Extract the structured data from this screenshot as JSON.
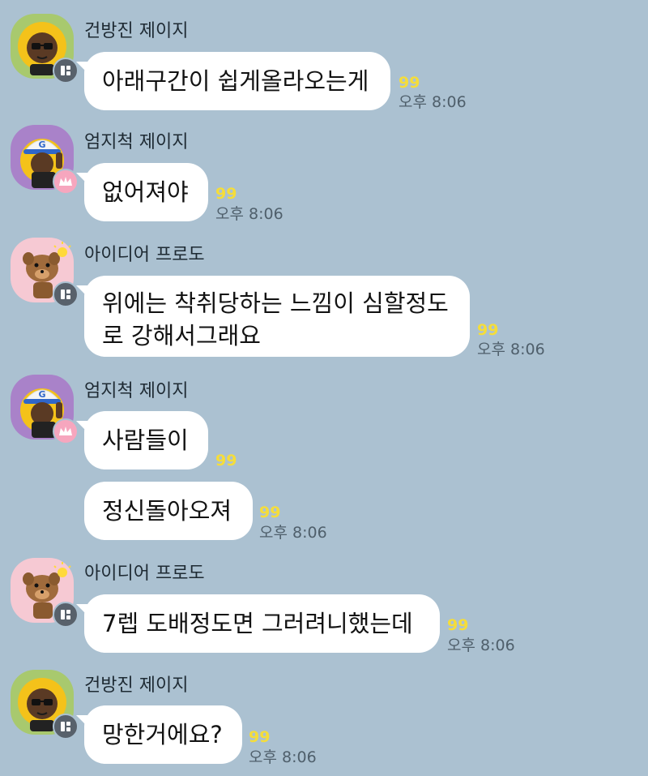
{
  "colors": {
    "background": "#abc1d1",
    "bubble": "#ffffff",
    "unread": "#f5dd3a",
    "avatar_green": "#a8c96e",
    "avatar_purple": "#a982c9",
    "avatar_pink": "#f6c9d3"
  },
  "messages": [
    {
      "sender": "건방진 제이지",
      "avatar": "jay-g-icon",
      "badge": "manager-badge-icon",
      "text": "아래구간이 쉽게올라오는게",
      "unread": "99",
      "time": "오후 8:06"
    },
    {
      "sender": "엄지척 제이지",
      "avatar": "jay-g-cap-icon",
      "badge": "crown-badge-icon",
      "text": "없어져야",
      "unread": "99",
      "time": "오후 8:06"
    },
    {
      "sender": "아이디어 프로도",
      "avatar": "frodo-icon",
      "badge": "manager-badge-icon",
      "text_lines": [
        "위에는 착취당하는 느낌이 심할정도",
        "로 강해서그래요"
      ],
      "unread": "99",
      "time": "오후 8:06"
    },
    {
      "sender": "엄지척 제이지",
      "avatar": "jay-g-cap-icon",
      "badge": "crown-badge-icon",
      "text": "사람들이",
      "unread": "99",
      "time": ""
    },
    {
      "sender": "",
      "text": "정신돌아오져",
      "unread": "99",
      "time": "오후 8:06"
    },
    {
      "sender": "아이디어 프로도",
      "avatar": "frodo-icon",
      "badge": "manager-badge-icon",
      "text": "7렙 도배정도면 그러려니했는데",
      "unread": "99",
      "time": "오후 8:06"
    },
    {
      "sender": "건방진 제이지",
      "avatar": "jay-g-icon",
      "badge": "manager-badge-icon",
      "text": "망한거에요?",
      "unread": "99",
      "time": "오후 8:06"
    }
  ]
}
